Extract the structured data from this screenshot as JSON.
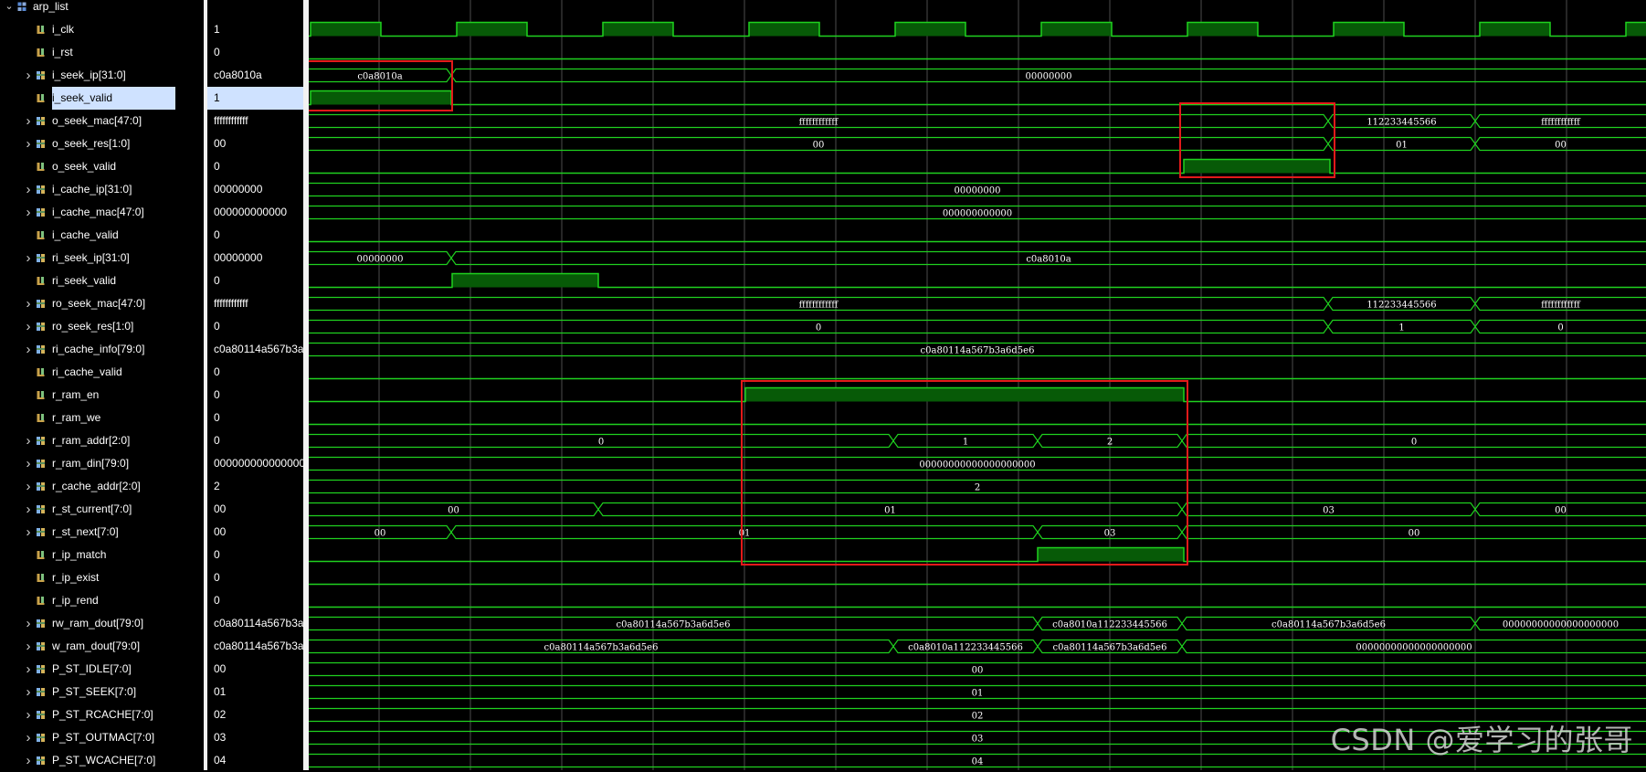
{
  "root": {
    "label": "arp_list",
    "chevron": "⌄",
    "icon": "module-icon"
  },
  "selected_signal": "i_seek_valid",
  "colors": {
    "wave": "#1fd11f",
    "fill": "#075a07",
    "grid": "#4d4d4d",
    "highlight": "#e31a1a",
    "selection": "#cfe2ff"
  },
  "signals": [
    {
      "name": "i_clk",
      "value": "1",
      "bus": false
    },
    {
      "name": "i_rst",
      "value": "0",
      "bus": false
    },
    {
      "name": "i_seek_ip[31:0]",
      "value": "c0a8010a",
      "bus": true
    },
    {
      "name": "i_seek_valid",
      "value": "1",
      "bus": false
    },
    {
      "name": "o_seek_mac[47:0]",
      "value": "ffffffffffff",
      "bus": true
    },
    {
      "name": "o_seek_res[1:0]",
      "value": "00",
      "bus": true
    },
    {
      "name": "o_seek_valid",
      "value": "0",
      "bus": false
    },
    {
      "name": "i_cache_ip[31:0]",
      "value": "00000000",
      "bus": true
    },
    {
      "name": "i_cache_mac[47:0]",
      "value": "000000000000",
      "bus": true
    },
    {
      "name": "i_cache_valid",
      "value": "0",
      "bus": false
    },
    {
      "name": "ri_seek_ip[31:0]",
      "value": "00000000",
      "bus": true
    },
    {
      "name": "ri_seek_valid",
      "value": "0",
      "bus": false
    },
    {
      "name": "ro_seek_mac[47:0]",
      "value": "ffffffffffff",
      "bus": true
    },
    {
      "name": "ro_seek_res[1:0]",
      "value": "0",
      "bus": true
    },
    {
      "name": "ri_cache_info[79:0]",
      "value": "c0a80114a567b3a",
      "bus": true
    },
    {
      "name": "ri_cache_valid",
      "value": "0",
      "bus": false
    },
    {
      "name": "r_ram_en",
      "value": "0",
      "bus": false
    },
    {
      "name": "r_ram_we",
      "value": "0",
      "bus": false
    },
    {
      "name": "r_ram_addr[2:0]",
      "value": "0",
      "bus": true
    },
    {
      "name": "r_ram_din[79:0]",
      "value": "000000000000000",
      "bus": true
    },
    {
      "name": "r_cache_addr[2:0]",
      "value": "2",
      "bus": true
    },
    {
      "name": "r_st_current[7:0]",
      "value": "00",
      "bus": true
    },
    {
      "name": "r_st_next[7:0]",
      "value": "00",
      "bus": true
    },
    {
      "name": "r_ip_match",
      "value": "0",
      "bus": false
    },
    {
      "name": "r_ip_exist",
      "value": "0",
      "bus": false
    },
    {
      "name": "r_ip_rend",
      "value": "0",
      "bus": false
    },
    {
      "name": "rw_ram_dout[79:0]",
      "value": "c0a80114a567b3a",
      "bus": true
    },
    {
      "name": "w_ram_dout[79:0]",
      "value": "c0a80114a567b3a",
      "bus": true
    },
    {
      "name": "P_ST_IDLE[7:0]",
      "value": "00",
      "bus": true
    },
    {
      "name": "P_ST_SEEK[7:0]",
      "value": "01",
      "bus": true
    },
    {
      "name": "P_ST_RCACHE[7:0]",
      "value": "02",
      "bus": true
    },
    {
      "name": "P_ST_OUTMAC[7:0]",
      "value": "03",
      "bus": true
    },
    {
      "name": "P_ST_WCACHE[7:0]",
      "value": "04",
      "bus": true
    }
  ],
  "waveform_segments": [
    [
      "c0a8010a",
      "00000000"
    ],
    [
      "ffffffffffff",
      "112233445566",
      "ffffffffffff"
    ],
    [
      "00",
      "01",
      "00"
    ],
    [
      "00000000"
    ],
    [
      "000000000000"
    ],
    [
      "00000000",
      "c0a8010a"
    ],
    [
      "ffffffffffff",
      "112233445566",
      "ffffffffffff"
    ],
    [
      "0",
      "1",
      "0"
    ],
    [
      "c0a80114a567b3a6d5e6"
    ],
    [
      "0",
      "1",
      "2",
      "0"
    ],
    [
      "00000000000000000000"
    ],
    [
      "2"
    ],
    [
      "00",
      "01",
      "03",
      "00"
    ],
    [
      "00",
      "01",
      "03",
      "00"
    ],
    [
      "c0a80114a567b3a6d5e6",
      "c0a8010a112233445566",
      "c0a80114a567b3a6d5e6",
      "00000000000000000000"
    ],
    [
      "c0a80114a567b3a6d5e6",
      "c0a8010a112233445566",
      "c0a80114a567b3a6d5e6",
      "00000000000000000000"
    ],
    [
      "00"
    ],
    [
      "01"
    ],
    [
      "02"
    ],
    [
      "03"
    ],
    [
      "04"
    ]
  ],
  "watermark": "CSDN @爱学习的张哥"
}
